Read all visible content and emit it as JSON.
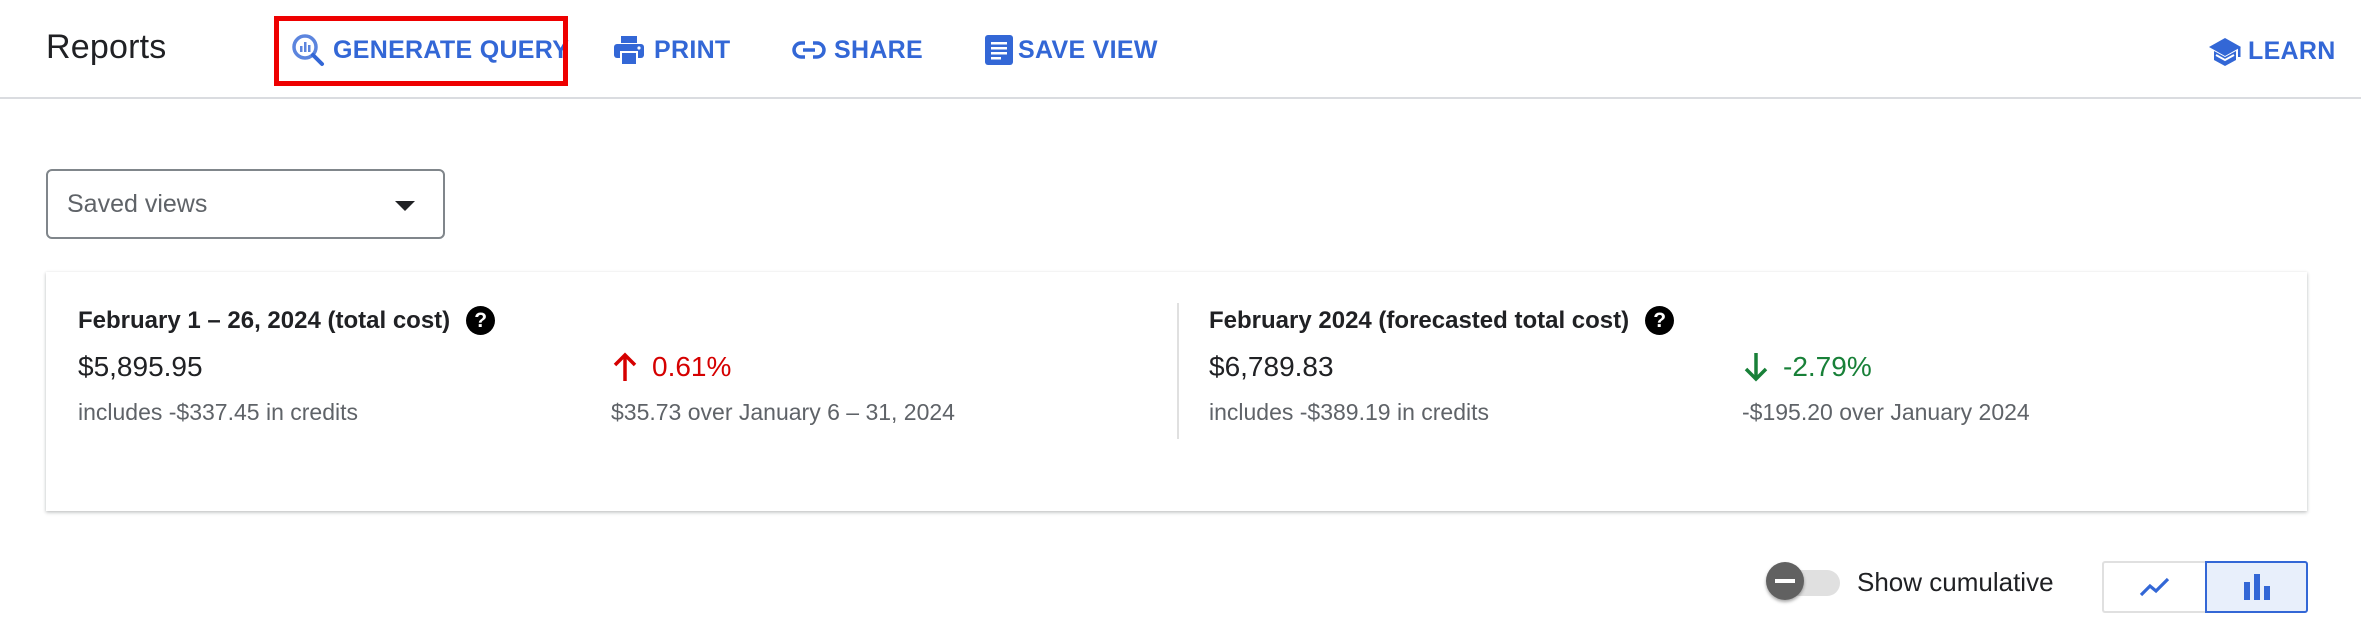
{
  "header": {
    "title": "Reports",
    "toolbar": [
      {
        "label": "GENERATE QUERY",
        "icon": "query-search-icon",
        "highlighted": true
      },
      {
        "label": "PRINT",
        "icon": "print-icon"
      },
      {
        "label": "SHARE",
        "icon": "link-icon"
      },
      {
        "label": "SAVE VIEW",
        "icon": "document-icon"
      }
    ],
    "learn": {
      "label": "LEARN",
      "icon": "school-icon"
    }
  },
  "colors": {
    "accent": "#3367d6",
    "highlight_box": "#ee0000",
    "increase": "#d50000",
    "decrease": "#188038"
  },
  "saved_views": {
    "label": "Saved views"
  },
  "summary": {
    "actual": {
      "title": "February 1 – 26, 2024 (total cost)",
      "amount": "$5,895.95",
      "credits": "includes -$337.45 in credits",
      "change": {
        "direction": "up",
        "percent": "0.61%",
        "detail": "$35.73 over January 6 – 31, 2024"
      }
    },
    "forecast": {
      "title": "February 2024 (forecasted total cost)",
      "amount": "$6,789.83",
      "credits": "includes -$389.19 in credits",
      "change": {
        "direction": "down",
        "percent": "-2.79%",
        "detail": "-$195.20 over January 2024"
      }
    },
    "help_glyph": "?"
  },
  "controls": {
    "show_cumulative": {
      "label": "Show cumulative",
      "checked": false
    },
    "chart_type": {
      "options": [
        "line",
        "bar"
      ],
      "selected": "bar"
    }
  }
}
